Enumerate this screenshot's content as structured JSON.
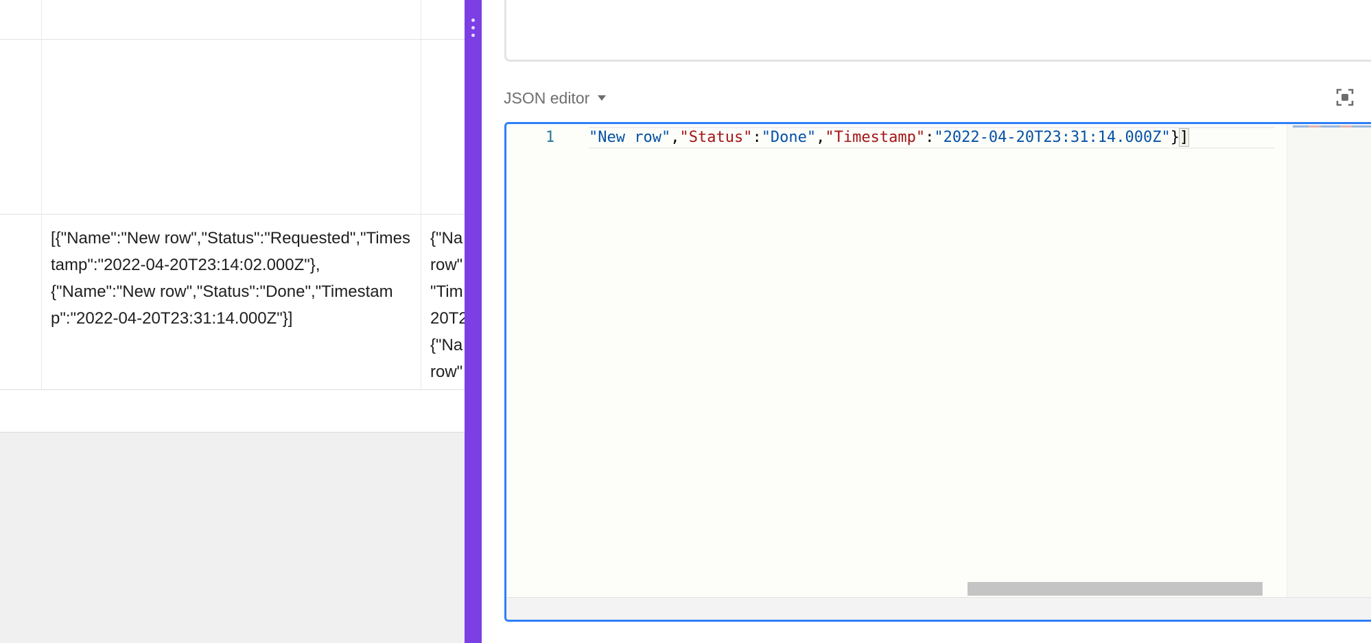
{
  "table": {
    "cells": {
      "col_a_row": "[{\"Name\":\"New row\",\"Status\":\"Requested\",\"Timestamp\":\"2022-04-20T23:14:02.000Z\"},\n{\"Name\":\"New row\",\"Status\":\"Done\",\"Timestamp\":\"2022-04-20T23:31:14.000Z\"}]",
      "col_b_row_clipped": "{\"Na\nrow\"\n\"Tim\n20T2\n{\"Na\nrow\""
    }
  },
  "editor": {
    "header_label": "JSON editor",
    "line_number": "1",
    "tokens": {
      "t1": "\"New row\"",
      "t2": ",",
      "t3": "\"Status\"",
      "t4": ":",
      "t5": "\"Done\"",
      "t6": ",",
      "t7": "\"Timestamp\"",
      "t8": ":",
      "t9": "\"2022-04-20T23:31:14.000Z\"",
      "t10": "}",
      "t11": "]"
    }
  },
  "colors": {
    "accent_purple": "#7b3fe4",
    "focus_blue": "#2d7ff9",
    "json_string": "#0451a5",
    "json_key": "#a31515"
  },
  "icons": {
    "resize": "drag-handle-icon",
    "expand": "expand-icon",
    "dropdown": "caret-down-icon"
  }
}
